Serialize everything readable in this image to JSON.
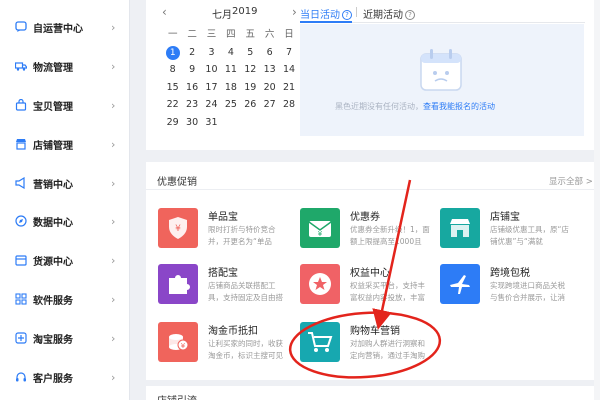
{
  "sidebar": {
    "items": [
      {
        "label": "自运营中心",
        "icon": "chat-icon"
      },
      {
        "label": "物流管理",
        "icon": "truck-icon"
      },
      {
        "label": "宝贝管理",
        "icon": "bag-icon"
      },
      {
        "label": "店铺管理",
        "icon": "store-icon"
      },
      {
        "label": "营销中心",
        "icon": "megaphone-icon"
      },
      {
        "label": "数据中心",
        "icon": "compass-icon"
      },
      {
        "label": "货源中心",
        "icon": "box-icon"
      },
      {
        "label": "软件服务",
        "icon": "grid-icon"
      },
      {
        "label": "淘宝服务",
        "icon": "taobao-icon"
      },
      {
        "label": "客户服务",
        "icon": "headset-icon"
      }
    ],
    "chevron": "›"
  },
  "calendar": {
    "prev": "‹",
    "next": "›",
    "month": "七月",
    "year": "2019",
    "weekdays": [
      "一",
      "二",
      "三",
      "四",
      "五",
      "六",
      "日"
    ],
    "rows": [
      [
        "1",
        "2",
        "3",
        "4",
        "5",
        "6",
        "7"
      ],
      [
        "8",
        "9",
        "10",
        "11",
        "12",
        "13",
        "14"
      ],
      [
        "15",
        "16",
        "17",
        "18",
        "19",
        "20",
        "21"
      ],
      [
        "22",
        "23",
        "24",
        "25",
        "26",
        "27",
        "28"
      ],
      [
        "29",
        "30",
        "31",
        "",
        "",
        "",
        ""
      ]
    ],
    "today": "1"
  },
  "activity": {
    "tab_current": "当日活动",
    "tab_recent": "近期活动",
    "help": "?",
    "empty_text": "黑色近期没有任何活动，",
    "empty_link": "查看我能报名的活动"
  },
  "promo": {
    "title": "优惠促销",
    "more": "显示全部 >",
    "tiles": [
      {
        "title": "单品宝",
        "desc": "限时打折与特价竞合并，开更名为“单品",
        "color": "#f0645c",
        "icon": "shield-yen-icon"
      },
      {
        "title": "优惠券",
        "desc": "优惠券全新升级！1，面额上限提高至1000且",
        "color": "#1fa86a",
        "icon": "envelope-yen-icon"
      },
      {
        "title": "店铺宝",
        "desc": "店铺级优惠工具，原“店铺优惠”与“满就",
        "color": "#17a8a0",
        "icon": "shop-icon"
      },
      {
        "title": "搭配宝",
        "desc": "店铺商品关联搭配工具，支持固定及自由搭",
        "color": "#8a46c8",
        "icon": "puzzle-icon"
      },
      {
        "title": "权益中心",
        "desc": "权益采买平台，支持丰富权益内容投放，丰富",
        "color": "#f06266",
        "icon": "star-badge-icon"
      },
      {
        "title": "跨境包税",
        "desc": "实现跨境进口商品关税与售价合并展示，让消",
        "color": "#2d7cf6",
        "icon": "plane-icon"
      },
      {
        "title": "淘金币抵扣",
        "desc": "让利买家的同时，收获淘金币，标识主搜可见",
        "color": "#f0645c",
        "icon": "coin-stack-icon"
      },
      {
        "title": "购物车营销",
        "desc": "对加购人群进行洞察和定向营销，通过手淘购",
        "color": "#17a8b0",
        "icon": "cart-icon"
      }
    ]
  },
  "bottom": {
    "title": "店铺引流"
  },
  "annotation": {
    "arrow_color": "#e3241c"
  }
}
